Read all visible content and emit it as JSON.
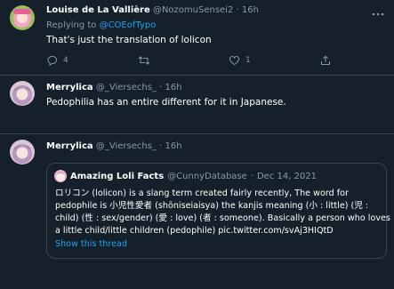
{
  "tweet1": {
    "name": "Louise de La Vallière",
    "handle": "@NozomuSensei2",
    "dot": "·",
    "time": "16h",
    "replying_prefix": "Replying to",
    "replying_to": "@COEofTypo",
    "text": "That's just the translation of lolicon",
    "reply_count": "4",
    "retweet_count": "",
    "like_count": "1"
  },
  "tweet2": {
    "name": "Merrylica",
    "handle": "@_Viersechs_",
    "dot": "·",
    "time": "16h",
    "text": "Pedophilia has an entire different for it in Japanese."
  },
  "tweet3": {
    "name": "Merrylica",
    "handle": "@_Viersechs_",
    "dot": "·",
    "time": "16h"
  },
  "quote": {
    "name": "Amazing Loli Facts",
    "handle": "@CunnyDatabase",
    "dot": "·",
    "date": "Dec 14, 2021",
    "lines": [
      "ロリコン (lolicon) is a slang term created fairly recently, The word for",
      "pedophile is 小児性愛者 (shōniseiaisya) the kanjis meaning (小 : little) (児 :",
      "child) (性 : sex/gender) (愛 : love) (者 : someone). Basically a person who loves",
      "a little child/little children (pedophile) pic.twitter.com/svAj3HIQtD"
    ],
    "show_thread": "Show this thread"
  },
  "icons": {
    "reply": "reply-icon",
    "retweet": "retweet-icon",
    "like": "heart-icon",
    "share": "share-icon",
    "more": "more-icon"
  },
  "colors": {
    "background": "#15202b",
    "text_secondary": "#8899a6",
    "link": "#1da1f2",
    "border": "#38444d"
  }
}
